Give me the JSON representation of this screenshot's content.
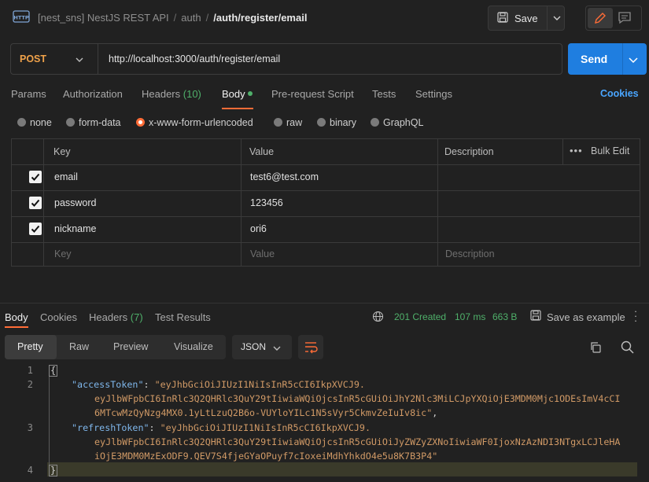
{
  "header": {
    "breadcrumb": [
      "[nest_sns] NestJS REST API",
      "auth"
    ],
    "current": "/auth/register/email",
    "save_label": "Save"
  },
  "request": {
    "method": "POST",
    "url": "http://localhost:3000/auth/register/email",
    "send_label": "Send",
    "tabs": [
      {
        "label": "Params"
      },
      {
        "label": "Authorization"
      },
      {
        "label": "Headers",
        "count": "(10)"
      },
      {
        "label": "Body",
        "active": true
      },
      {
        "label": "Pre-request Script"
      },
      {
        "label": "Tests"
      },
      {
        "label": "Settings"
      }
    ],
    "cookies_label": "Cookies",
    "body_types": [
      "none",
      "form-data",
      "x-www-form-urlencoded",
      "raw",
      "binary",
      "GraphQL"
    ],
    "selected_body_type": "x-www-form-urlencoded",
    "table": {
      "headers": [
        "Key",
        "Value",
        "Description"
      ],
      "bulk_edit": "Bulk Edit",
      "rows": [
        {
          "key": "email",
          "value": "test6@test.com",
          "checked": true
        },
        {
          "key": "password",
          "value": "123456",
          "checked": true
        },
        {
          "key": "nickname",
          "value": "ori6",
          "checked": true
        }
      ],
      "placeholders": {
        "key": "Key",
        "value": "Value",
        "description": "Description"
      }
    }
  },
  "response": {
    "tabs": [
      {
        "label": "Body",
        "active": true
      },
      {
        "label": "Cookies"
      },
      {
        "label": "Headers",
        "count": "(7)"
      },
      {
        "label": "Test Results"
      }
    ],
    "status": "201 Created",
    "time": "107 ms",
    "size": "663 B",
    "save_example": "Save as example",
    "view_modes": [
      "Pretty",
      "Raw",
      "Preview",
      "Visualize"
    ],
    "format": "JSON",
    "code": {
      "line_numbers": [
        "1",
        "2",
        "3",
        "4"
      ],
      "open": "{",
      "close": "}",
      "access_key": "\"accessToken\"",
      "access_val": [
        "\"eyJhbGciOiJIUzI1NiIsInR5cCI6IkpXVCJ9.",
        "eyJlbWFpbCI6InRlc3Q2QHRlc3QuY29tIiwiaWQiOjcsInR5cGUiOiJhY2Nlc3MiLCJpYXQiOjE3MDM0Mjc1ODEsImV4cCI",
        "6MTcwMzQyNzg4MX0.1yLtLzuQ2B6o-VUYloYILc1N5sVyr5CkmvZeIuIv8ic\""
      ],
      "refresh_key": "\"refreshToken\"",
      "refresh_val": [
        "\"eyJhbGciOiJIUzI1NiIsInR5cCI6IkpXVCJ9.",
        "eyJlbWFpbCI6InRlc3Q2QHRlc3QuY29tIiwiaWQiOjcsInR5cGUiOiJyZWZyZXNoIiwiaWF0IjoxNzAzNDI3NTgxLCJleHA",
        "iOjE3MDM0MzExODF9.QEV7S4fjeGYaOPuyf7cIoxeiMdhYhkdO4e5u8K7B3P4\""
      ]
    },
    "colors": {
      "accent": "#ff6c37",
      "send": "#1f7ee0",
      "status_ok": "#4fb06a"
    }
  }
}
